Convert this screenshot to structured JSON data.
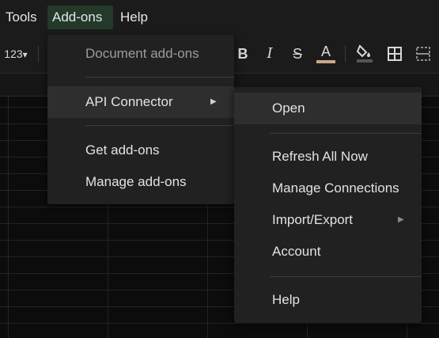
{
  "menubar": {
    "tools": "Tools",
    "addons": "Add-ons",
    "help": "Help"
  },
  "toolbar": {
    "number_format": "123",
    "bold": "B",
    "italic": "I",
    "strikethrough": "S",
    "text_color": "A",
    "text_color_bar": "#c9a98a"
  },
  "addons_menu": {
    "document_addons": "Document add-ons",
    "api_connector": "API Connector",
    "get_addons": "Get add-ons",
    "manage_addons": "Manage add-ons"
  },
  "api_submenu": {
    "open": "Open",
    "refresh_all": "Refresh All Now",
    "manage_connections": "Manage Connections",
    "import_export": "Import/Export",
    "account": "Account",
    "help": "Help"
  },
  "icons": {
    "submenu_arrow": "▶",
    "caret_down": "▾"
  }
}
